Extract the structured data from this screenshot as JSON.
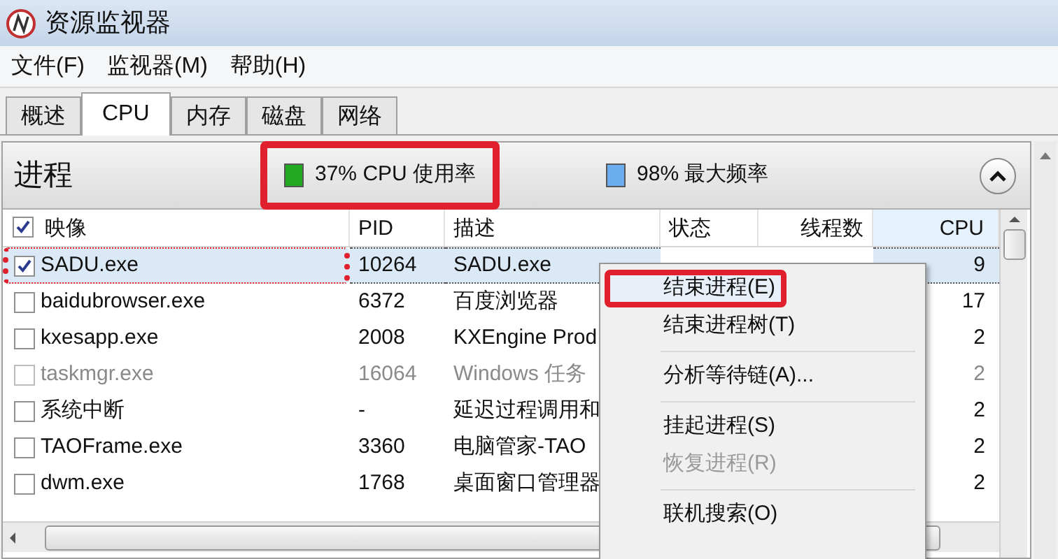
{
  "window": {
    "title": "资源监视器"
  },
  "menu_bar": [
    "文件(F)",
    "监视器(M)",
    "帮助(H)"
  ],
  "tabs": [
    {
      "label": "概述",
      "selected": false
    },
    {
      "label": "CPU",
      "selected": true
    },
    {
      "label": "内存",
      "selected": false
    },
    {
      "label": "磁盘",
      "selected": false
    },
    {
      "label": "网络",
      "selected": false
    }
  ],
  "section": {
    "title": "进程",
    "cpu_usage": {
      "text": "37% CPU 使用率",
      "color": "#22aa22",
      "highlighted": true
    },
    "max_frequency": {
      "text": "98% 最大频率",
      "color": "#6aaef0"
    },
    "expanded": true
  },
  "table": {
    "columns": [
      {
        "label": "映像",
        "checked": true
      },
      {
        "label": "PID"
      },
      {
        "label": "描述"
      },
      {
        "label": "状态"
      },
      {
        "label": "线程数"
      },
      {
        "label": "CPU",
        "sorted": true
      }
    ],
    "rows": [
      {
        "image": "SADU.exe",
        "pid": "10264",
        "description": "SADU.exe",
        "cpu": "9",
        "checked": true,
        "selected": true,
        "disabled": false,
        "highlighted": true
      },
      {
        "image": "baidubrowser.exe",
        "pid": "6372",
        "description": "百度浏览器",
        "cpu": "17",
        "checked": false,
        "selected": false,
        "disabled": false,
        "highlighted": false
      },
      {
        "image": "kxesapp.exe",
        "pid": "2008",
        "description": "KXEngine Prod",
        "cpu": "2",
        "checked": false,
        "selected": false,
        "disabled": false,
        "highlighted": false
      },
      {
        "image": "taskmgr.exe",
        "pid": "16064",
        "description": "Windows 任务",
        "cpu": "2",
        "checked": false,
        "selected": false,
        "disabled": true,
        "highlighted": false
      },
      {
        "image": "系统中断",
        "pid": "-",
        "description": "延迟过程调用和",
        "cpu": "2",
        "checked": false,
        "selected": false,
        "disabled": false,
        "highlighted": false
      },
      {
        "image": "TAOFrame.exe",
        "pid": "3360",
        "description": "电脑管家-TAO",
        "cpu": "2",
        "checked": false,
        "selected": false,
        "disabled": false,
        "highlighted": false
      },
      {
        "image": "dwm.exe",
        "pid": "1768",
        "description": "桌面窗口管理器",
        "cpu": "2",
        "checked": false,
        "selected": false,
        "disabled": false,
        "highlighted": false
      }
    ]
  },
  "context_menu": [
    {
      "kind": "item",
      "label": "结束进程(E)",
      "disabled": false,
      "highlighted": true
    },
    {
      "kind": "item",
      "label": "结束进程树(T)",
      "disabled": false,
      "highlighted": false
    },
    {
      "kind": "separator"
    },
    {
      "kind": "item",
      "label": "分析等待链(A)...",
      "disabled": false,
      "highlighted": false
    },
    {
      "kind": "separator"
    },
    {
      "kind": "item",
      "label": "挂起进程(S)",
      "disabled": false,
      "highlighted": false
    },
    {
      "kind": "item",
      "label": "恢复进程(R)",
      "disabled": true,
      "highlighted": false
    },
    {
      "kind": "separator"
    },
    {
      "kind": "item",
      "label": "联机搜索(O)",
      "disabled": false,
      "highlighted": false
    }
  ]
}
